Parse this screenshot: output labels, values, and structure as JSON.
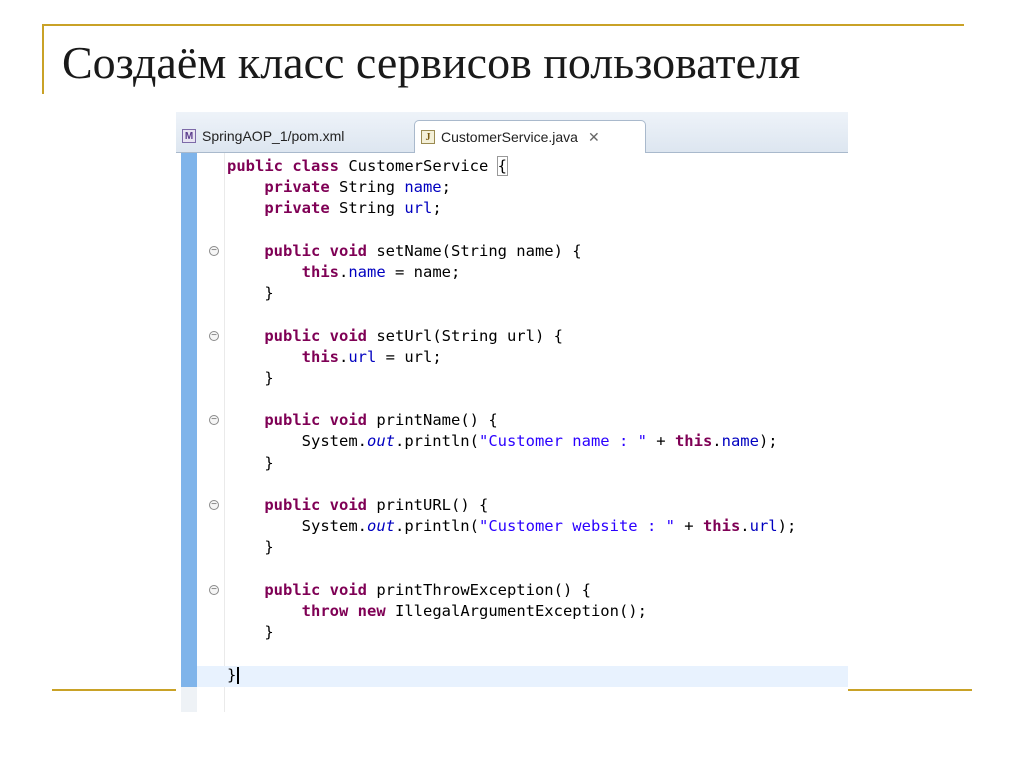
{
  "slide": {
    "title": "Создаём класс сервисов пользователя"
  },
  "editor": {
    "tabs": [
      {
        "label": "SpringAOP_1/pom.xml",
        "icon": "maven-pom-file-icon",
        "active": false
      },
      {
        "label": "CustomerService.java",
        "icon": "java-file-icon",
        "active": true
      }
    ],
    "close_glyph": "✕"
  },
  "code": {
    "lines": [
      [
        [
          "kw",
          "public"
        ],
        [
          "t",
          " "
        ],
        [
          "kw",
          "class"
        ],
        [
          "t",
          " CustomerService "
        ],
        [
          "b",
          "{"
        ]
      ],
      [
        [
          "t",
          "    "
        ],
        [
          "kw",
          "private"
        ],
        [
          "t",
          " String "
        ],
        [
          "fld",
          "name"
        ],
        [
          "t",
          ";"
        ]
      ],
      [
        [
          "t",
          "    "
        ],
        [
          "kw",
          "private"
        ],
        [
          "t",
          " String "
        ],
        [
          "fld",
          "url"
        ],
        [
          "t",
          ";"
        ]
      ],
      [],
      [
        [
          "t",
          "    "
        ],
        [
          "kw",
          "public"
        ],
        [
          "t",
          " "
        ],
        [
          "kw",
          "void"
        ],
        [
          "t",
          " setName(String name) {"
        ]
      ],
      [
        [
          "t",
          "        "
        ],
        [
          "kw",
          "this"
        ],
        [
          "t",
          "."
        ],
        [
          "fld",
          "name"
        ],
        [
          "t",
          " = name;"
        ]
      ],
      [
        [
          "t",
          "    }"
        ]
      ],
      [],
      [
        [
          "t",
          "    "
        ],
        [
          "kw",
          "public"
        ],
        [
          "t",
          " "
        ],
        [
          "kw",
          "void"
        ],
        [
          "t",
          " setUrl(String url) {"
        ]
      ],
      [
        [
          "t",
          "        "
        ],
        [
          "kw",
          "this"
        ],
        [
          "t",
          "."
        ],
        [
          "fld",
          "url"
        ],
        [
          "t",
          " = url;"
        ]
      ],
      [
        [
          "t",
          "    }"
        ]
      ],
      [],
      [
        [
          "t",
          "    "
        ],
        [
          "kw",
          "public"
        ],
        [
          "t",
          " "
        ],
        [
          "kw",
          "void"
        ],
        [
          "t",
          " printName() {"
        ]
      ],
      [
        [
          "t",
          "        System."
        ],
        [
          "stat",
          "out"
        ],
        [
          "t",
          ".println("
        ],
        [
          "str",
          "\"Customer name : \""
        ],
        [
          "t",
          " + "
        ],
        [
          "kw",
          "this"
        ],
        [
          "t",
          "."
        ],
        [
          "fld",
          "name"
        ],
        [
          "t",
          ");"
        ]
      ],
      [
        [
          "t",
          "    }"
        ]
      ],
      [],
      [
        [
          "t",
          "    "
        ],
        [
          "kw",
          "public"
        ],
        [
          "t",
          " "
        ],
        [
          "kw",
          "void"
        ],
        [
          "t",
          " printURL() {"
        ]
      ],
      [
        [
          "t",
          "        System."
        ],
        [
          "stat",
          "out"
        ],
        [
          "t",
          ".println("
        ],
        [
          "str",
          "\"Customer website : \""
        ],
        [
          "t",
          " + "
        ],
        [
          "kw",
          "this"
        ],
        [
          "t",
          "."
        ],
        [
          "fld",
          "url"
        ],
        [
          "t",
          ");"
        ]
      ],
      [
        [
          "t",
          "    }"
        ]
      ],
      [],
      [
        [
          "t",
          "    "
        ],
        [
          "kw",
          "public"
        ],
        [
          "t",
          " "
        ],
        [
          "kw",
          "void"
        ],
        [
          "t",
          " printThrowException() {"
        ]
      ],
      [
        [
          "t",
          "        "
        ],
        [
          "kw",
          "throw"
        ],
        [
          "t",
          " "
        ],
        [
          "kw",
          "new"
        ],
        [
          "t",
          " IllegalArgumentException();"
        ]
      ],
      [
        [
          "t",
          "    }"
        ]
      ],
      [],
      [
        [
          "t",
          "}"
        ],
        [
          "c",
          ""
        ]
      ]
    ],
    "fold_marker_lines": [
      4,
      8,
      12,
      16,
      20
    ]
  }
}
